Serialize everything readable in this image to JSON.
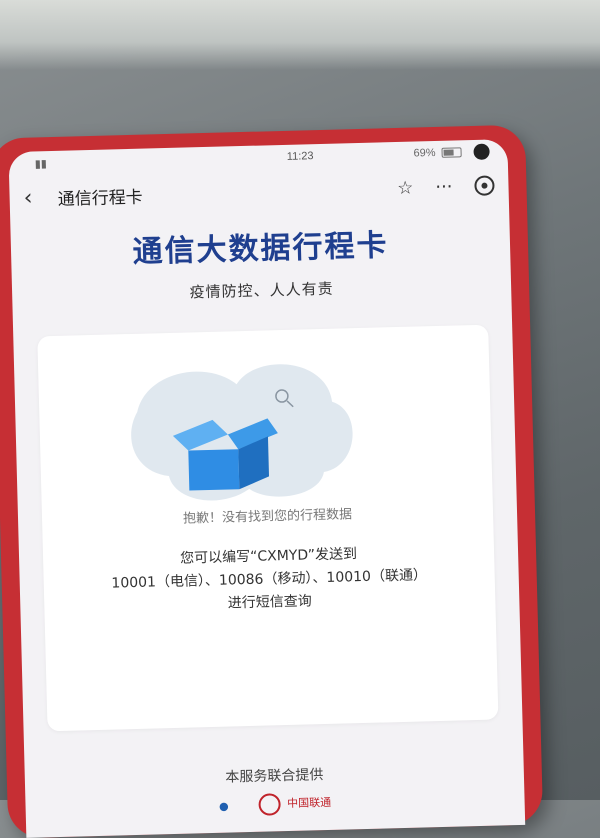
{
  "status_bar": {
    "time": "11:23",
    "battery": "69%"
  },
  "app_bar": {
    "back_icon": "chevron-left-icon",
    "title": "通信行程卡",
    "star_icon": "star-icon",
    "more_icon": "more-icon",
    "record_icon": "record-icon"
  },
  "page": {
    "title": "通信大数据行程卡",
    "subtitle": "疫情防控、人人有责"
  },
  "card": {
    "illustration_icon": "empty-box-icon",
    "sorry_text": "抱歉！没有找到您的行程数据",
    "instruction_line1": "您可以编写“CXMYD”发送到",
    "instruction_line2": "10001（电信）、10086（移动）、10010（联通）",
    "instruction_line3": "进行短信查询"
  },
  "footer": {
    "provided_by": "本服务联合提供",
    "logo_unicom": "中国联通"
  },
  "colors": {
    "title_blue": "#1f3f8f",
    "phone_red": "#c62f34",
    "box_blue": "#2f8de4"
  }
}
